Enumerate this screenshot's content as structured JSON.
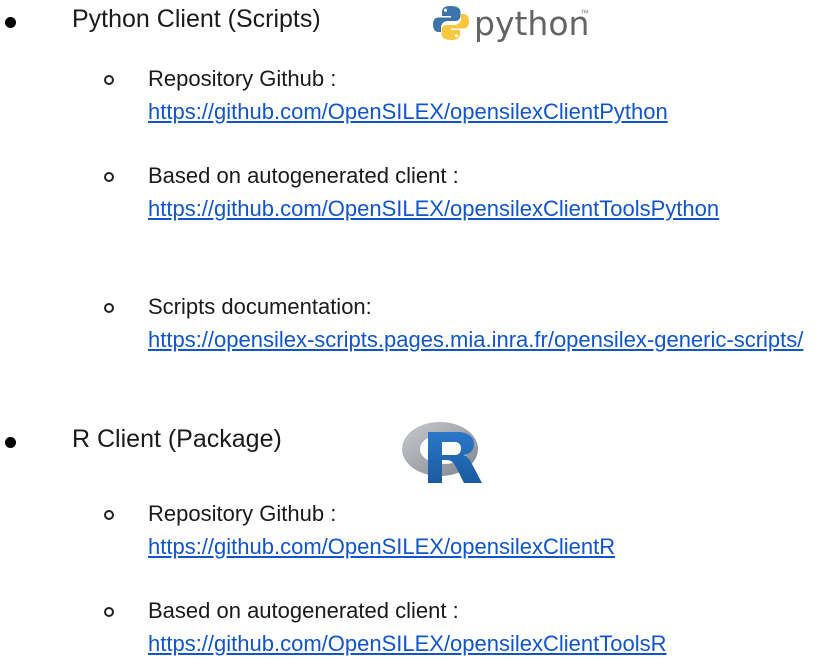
{
  "python_section": {
    "heading": "Python Client (Scripts)",
    "logo_text": "python",
    "logo_tm": "™",
    "items": [
      {
        "label": "Repository Github :",
        "link": "https://github.com/OpenSILEX/opensilexClientPython"
      },
      {
        "label": "Based on autogenerated client :",
        "link": "https://github.com/OpenSILEX/opensilexClientToolsPython"
      },
      {
        "label": "Scripts documentation:",
        "link": "https://opensilex-scripts.pages.mia.inra.fr/opensilex-generic-scripts/"
      }
    ]
  },
  "r_section": {
    "heading": "R Client (Package)",
    "logo_text": "R",
    "items": [
      {
        "label": "Repository Github :",
        "link": "https://github.com/OpenSILEX/opensilexClientR"
      },
      {
        "label": "Based on autogenerated client :",
        "link": "https://github.com/OpenSILEX/opensilexClientToolsR"
      }
    ]
  },
  "colors": {
    "link": "#1155cc",
    "text": "#1a1a1a",
    "python_blue": "#3a74a8",
    "python_yellow": "#f7c73c",
    "r_gray": "#9a9ea6",
    "r_blue": "#2166b3"
  }
}
